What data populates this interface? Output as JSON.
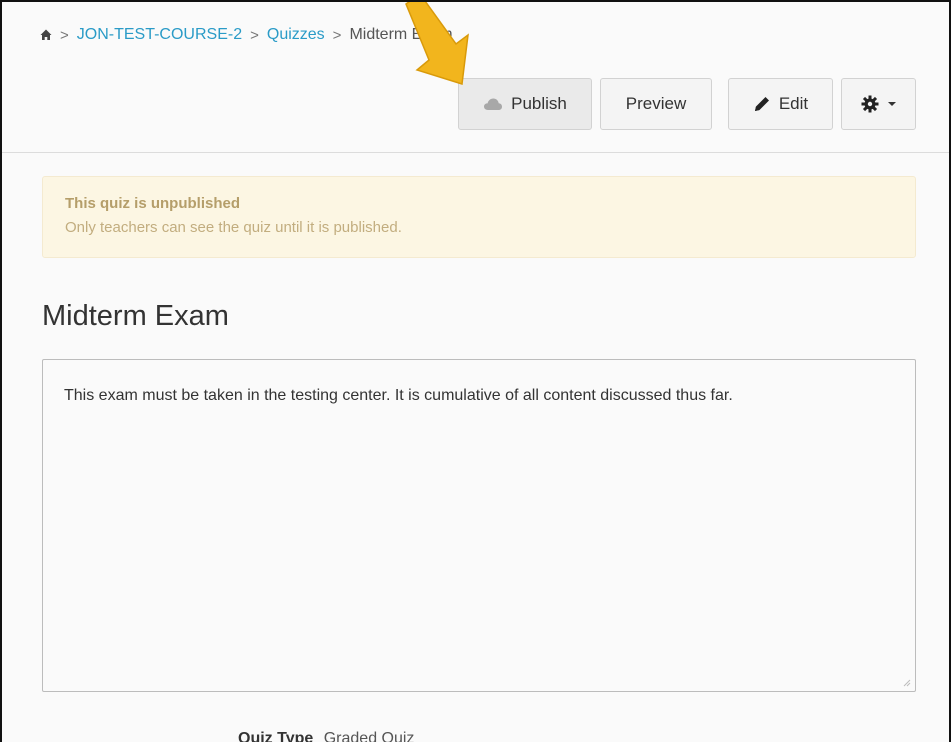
{
  "breadcrumb": {
    "home_icon": "home-icon",
    "course": "JON-TEST-COURSE-2",
    "section": "Quizzes",
    "current": "Midterm Exam",
    "separator": ">"
  },
  "toolbar": {
    "publish_label": "Publish",
    "preview_label": "Preview",
    "edit_label": "Edit",
    "publish_icon": "cloud-icon",
    "edit_icon": "pencil-icon",
    "settings_icon": "gear-icon",
    "settings_dropdown_icon": "caret-down-icon"
  },
  "alert": {
    "title": "This quiz is unpublished",
    "text": "Only teachers can see the quiz until it is published."
  },
  "quiz": {
    "title": "Midterm Exam",
    "description": "This exam must be taken in the testing center. It is cumulative of all content discussed thus far.",
    "type_label": "Quiz Type",
    "type_value": "Graded Quiz"
  },
  "annotation": {
    "arrow_icon": "callout-arrow-icon",
    "arrow_color": "#f2b51d"
  },
  "colors": {
    "link": "#2a9bc7",
    "alert_bg": "#fcf6e3",
    "alert_text": "#b59e6a"
  }
}
